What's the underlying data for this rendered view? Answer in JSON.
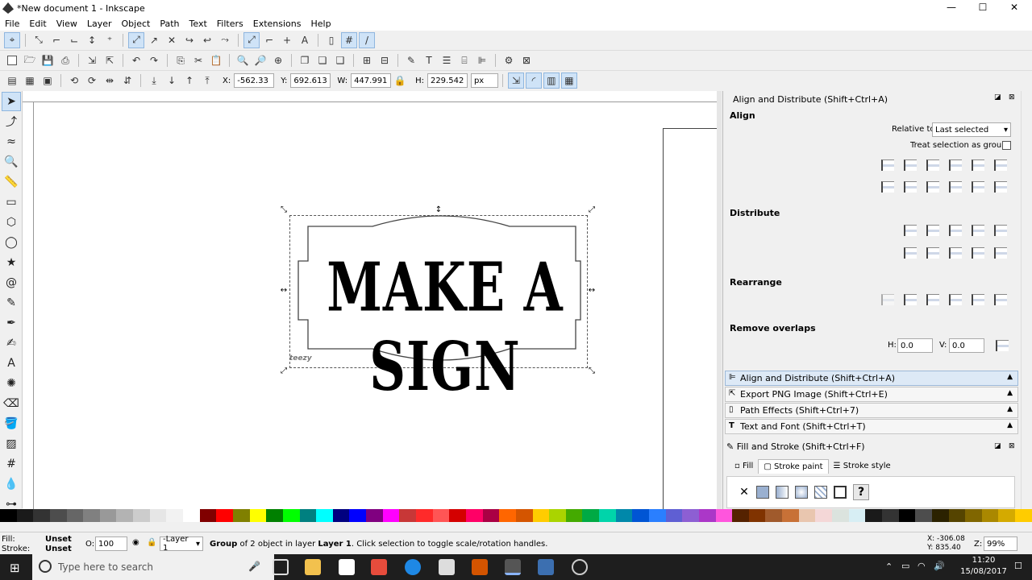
{
  "window": {
    "title": "*New document 1 - Inkscape",
    "minimize": "—",
    "maximize": "☐",
    "close": "✕"
  },
  "menu": [
    "File",
    "Edit",
    "View",
    "Layer",
    "Object",
    "Path",
    "Text",
    "Filters",
    "Extensions",
    "Help"
  ],
  "toolbar3": {
    "x_label": "X:",
    "x_value": "-562.33",
    "y_label": "Y:",
    "y_value": "692.613",
    "w_label": "W:",
    "w_value": "447.991",
    "h_label": "H:",
    "h_value": "229.542",
    "unit": "px"
  },
  "canvas": {
    "sign_text": "MAKE A SIGN",
    "watermark": "teezy"
  },
  "dock": {
    "title": "Align and Distribute (Shift+Ctrl+A)",
    "align_header": "Align",
    "relative_to_label": "Relative to:",
    "relative_to_value": "Last selected",
    "treat_group_label": "Treat selection as group:",
    "distribute_header": "Distribute",
    "rearrange_header": "Rearrange",
    "remove_overlaps_header": "Remove overlaps",
    "h_label": "H:",
    "h_value": "0.0",
    "v_label": "V:",
    "v_value": "0.0",
    "panels": [
      "Align and Distribute (Shift+Ctrl+A)",
      "Export PNG Image (Shift+Ctrl+E)",
      "Path Effects  (Shift+Ctrl+7)",
      "Text and Font (Shift+Ctrl+T)"
    ],
    "fill_stroke_title": "Fill and Stroke (Shift+Ctrl+F)",
    "tabs": [
      "Fill",
      "Stroke paint",
      "Stroke style"
    ]
  },
  "status": {
    "fill_label": "Fill:",
    "fill_value": "Unset",
    "stroke_label": "Stroke:",
    "stroke_value": "Unset",
    "opacity_label": "O:",
    "opacity_value": "100",
    "layer": "-Layer 1",
    "message_bold": "Group",
    "message": " of 2 object in layer ",
    "message_layer": "Layer 1",
    "message_tail": ". Click selection to toggle scale/rotation handles.",
    "cursor_x": "X: -306.08",
    "cursor_y": "Y:  835.40",
    "zoom_label": "Z:",
    "zoom_value": "99%"
  },
  "taskbar": {
    "search_placeholder": "Type here to search",
    "time": "11:20",
    "date": "15/08/2017"
  },
  "palette_colors": [
    "#000000",
    "#1a1a1a",
    "#333333",
    "#4d4d4d",
    "#666666",
    "#808080",
    "#999999",
    "#b3b3b3",
    "#cccccc",
    "#e6e6e6",
    "#f2f2f2",
    "#ffffff",
    "#800000",
    "#ff0000",
    "#808000",
    "#ffff00",
    "#008000",
    "#00ff00",
    "#008080",
    "#00ffff",
    "#000080",
    "#0000ff",
    "#800080",
    "#ff00ff",
    "#c83737",
    "#ff2a2a",
    "#ff5555",
    "#d40000",
    "#ff0066",
    "#aa0044",
    "#ff6600",
    "#d45500",
    "#ffcc00",
    "#aad400",
    "#44aa00",
    "#00aa44",
    "#00d4aa",
    "#0088aa",
    "#0055d4",
    "#2a7fff",
    "#5f5fd3",
    "#8d5fd3",
    "#ab37c8",
    "#ff55dd",
    "#552200",
    "#803300",
    "#a05a2c",
    "#c87137",
    "#e9c6af",
    "#f4d7d7",
    "#dbe3de",
    "#d7eef4",
    "#1a1a1a",
    "#333333",
    "#000000",
    "#4d4d4d",
    "#2b2200",
    "#554400",
    "#806600",
    "#aa8800",
    "#d4aa00",
    "#ffcc00"
  ]
}
